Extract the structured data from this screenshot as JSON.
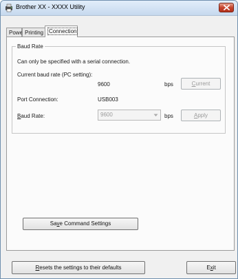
{
  "window": {
    "title": "Brother XX - XXXX Utility"
  },
  "tabs": [
    {
      "label": "Power"
    },
    {
      "label": "Printing"
    },
    {
      "label": "Connection"
    }
  ],
  "baud_group": {
    "legend": "Baud Rate",
    "note": "Can only be specified with a serial connection.",
    "current_label": "Current baud rate (PC setting):",
    "current_value": "9600",
    "current_unit": "bps",
    "current_button": {
      "prefix": "",
      "mnemonic": "C",
      "rest": "urrent"
    },
    "port_label": "Port Connection:",
    "port_value": "USB003",
    "baud_label": {
      "prefix": "",
      "mnemonic": "B",
      "rest": "aud Rate:"
    },
    "baud_select_value": "9600",
    "baud_unit": "bps",
    "apply_button": {
      "prefix": "",
      "mnemonic": "A",
      "rest": "pply"
    }
  },
  "save_button": {
    "prefix": "Sa",
    "mnemonic": "v",
    "rest": "e Command Settings"
  },
  "reset_button": {
    "prefix": "",
    "mnemonic": "R",
    "rest": "esets the settings to their defaults"
  },
  "exit_button": {
    "prefix": "E",
    "mnemonic": "x",
    "rest": "it"
  },
  "colors": {
    "window_bg": "#f0f0f0",
    "panel_bg": "#fbfbfb",
    "close_red": "#c5442d",
    "disabled_text": "#9a9a9a"
  }
}
